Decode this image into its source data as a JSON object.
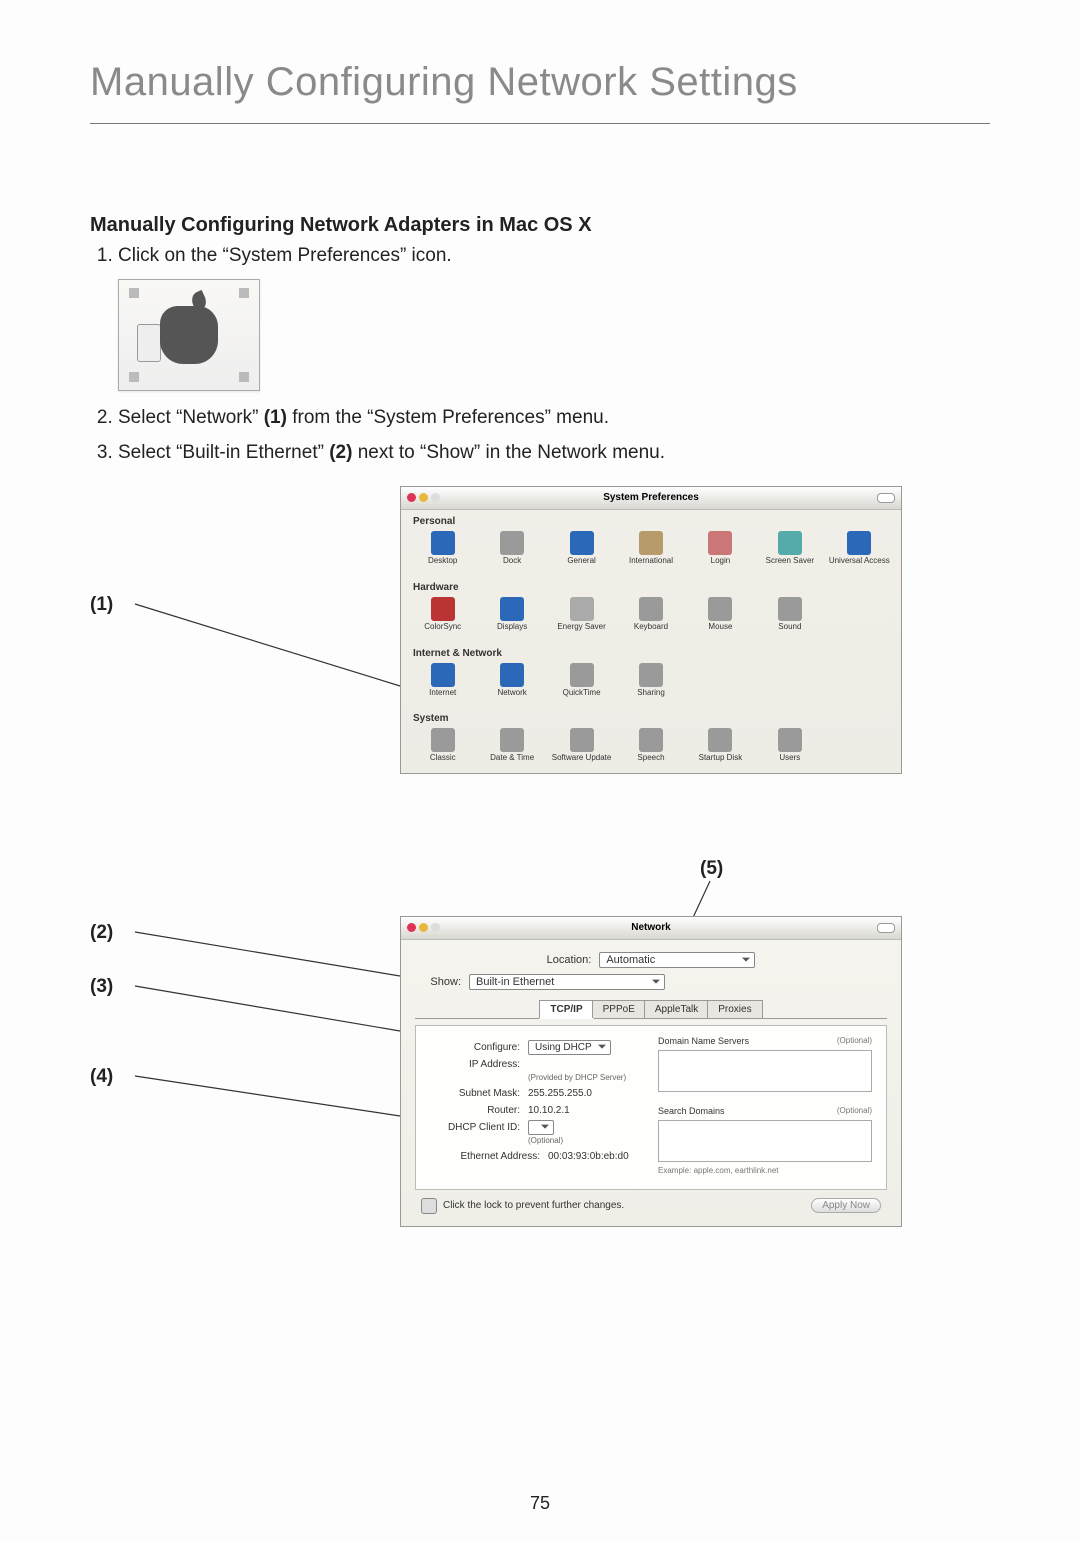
{
  "page_title": "Manually Configuring Network Settings",
  "section_title": "Manually Configuring Network Adapters in Mac OS X",
  "steps": {
    "s1": "Click on the “System Preferences” icon.",
    "s2_pre": "Select “Network” ",
    "s2_bold": "(1)",
    "s2_post": " from the “System Preferences” menu.",
    "s3_pre": "Select “Built-in Ethernet” ",
    "s3_bold": "(2)",
    "s3_post": " next to “Show” in the Network menu."
  },
  "callouts": {
    "c1": "(1)",
    "c2": "(2)",
    "c3": "(3)",
    "c4": "(4)",
    "c5": "(5)"
  },
  "sys_prefs": {
    "title": "System Preferences",
    "sections": {
      "personal": {
        "label": "Personal",
        "items": [
          "Desktop",
          "Dock",
          "General",
          "International",
          "Login",
          "Screen Saver",
          "Universal Access"
        ]
      },
      "hardware": {
        "label": "Hardware",
        "items": [
          "ColorSync",
          "Displays",
          "Energy Saver",
          "Keyboard",
          "Mouse",
          "Sound"
        ]
      },
      "internet": {
        "label": "Internet & Network",
        "items": [
          "Internet",
          "Network",
          "QuickTime",
          "Sharing"
        ]
      },
      "system": {
        "label": "System",
        "items": [
          "Classic",
          "Date & Time",
          "Software Update",
          "Speech",
          "Startup Disk",
          "Users"
        ]
      }
    }
  },
  "network": {
    "title": "Network",
    "location_label": "Location:",
    "location_value": "Automatic",
    "show_label": "Show:",
    "show_value": "Built-in Ethernet",
    "tabs": [
      "TCP/IP",
      "PPPoE",
      "AppleTalk",
      "Proxies"
    ],
    "configure_label": "Configure:",
    "configure_value": "Using DHCP",
    "ip_label": "IP Address:",
    "ip_note": "(Provided by DHCP Server)",
    "subnet_label": "Subnet Mask:",
    "subnet_value": "255.255.255.0",
    "router_label": "Router:",
    "router_value": "10.10.2.1",
    "dhcp_label": "DHCP Client ID:",
    "dhcp_note": "(Optional)",
    "eth_label": "Ethernet Address:",
    "eth_value": "00:03:93:0b:eb:d0",
    "dns_label": "Domain Name Servers",
    "dns_opt": "(Optional)",
    "search_label": "Search Domains",
    "search_opt": "(Optional)",
    "example": "Example: apple.com, earthlink.net",
    "lock_text": "Click the lock to prevent further changes.",
    "apply": "Apply Now"
  },
  "page_number": "75"
}
